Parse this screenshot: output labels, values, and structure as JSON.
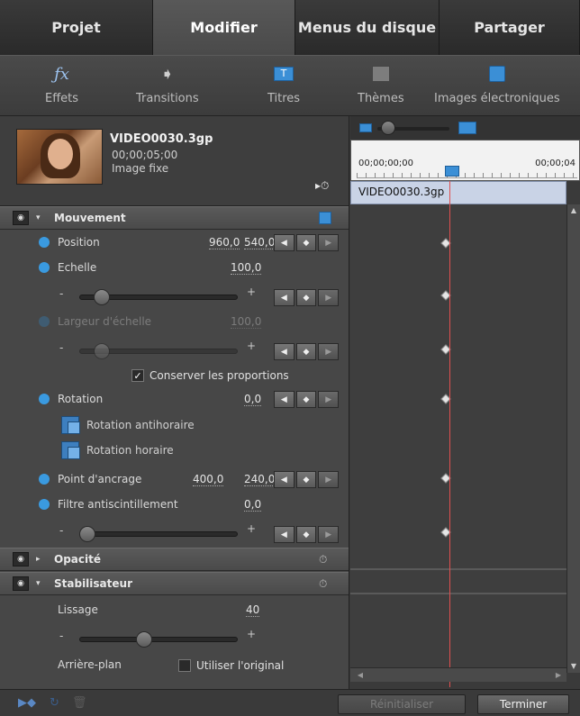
{
  "tabs": [
    {
      "label": "Projet",
      "active": false
    },
    {
      "label": "Modifier",
      "active": true
    },
    {
      "label": "Menus du disque",
      "active": false
    },
    {
      "label": "Partager",
      "active": false
    }
  ],
  "toolbar": {
    "effects": "Effets",
    "transitions": "Transitions",
    "titles": "Titres",
    "themes": "Thèmes",
    "clipart": "Images électroniques"
  },
  "clip": {
    "name": "VIDEO0030.3gp",
    "duration": "00;00;05;00",
    "type": "Image fixe"
  },
  "motion": {
    "title": "Mouvement",
    "position": {
      "label": "Position",
      "x": "960,0",
      "y": "540,0"
    },
    "scale": {
      "label": "Echelle",
      "value": "100,0",
      "slider": 0.1
    },
    "scale_width": {
      "label": "Largeur d'échelle",
      "value": "100,0",
      "slider": 0.1
    },
    "keep_proportions": "Conserver les proportions",
    "rotation": {
      "label": "Rotation",
      "value": "0,0"
    },
    "rotate_ccw": "Rotation antihoraire",
    "rotate_cw": "Rotation horaire",
    "anchor": {
      "label": "Point d'ancrage",
      "x": "400,0",
      "y": "240,0"
    },
    "antiflicker": {
      "label": "Filtre antiscintillement",
      "value": "0,0",
      "slider": 0.0
    }
  },
  "opacity": {
    "title": "Opacité"
  },
  "stabilizer": {
    "title": "Stabilisateur",
    "smoothing": {
      "label": "Lissage",
      "value": "40",
      "slider": 0.4
    },
    "background_label": "Arrière-plan",
    "use_original": "Utiliser l'original"
  },
  "timeline": {
    "start_tc": "00;00;00;00",
    "end_tc": "00;00;04",
    "clip_label": "VIDEO0030.3gp"
  },
  "footer": {
    "reset": "Réinitialiser",
    "done": "Terminer"
  },
  "colors": {
    "accent": "#3b8fd6",
    "playhead": "#e05050"
  }
}
